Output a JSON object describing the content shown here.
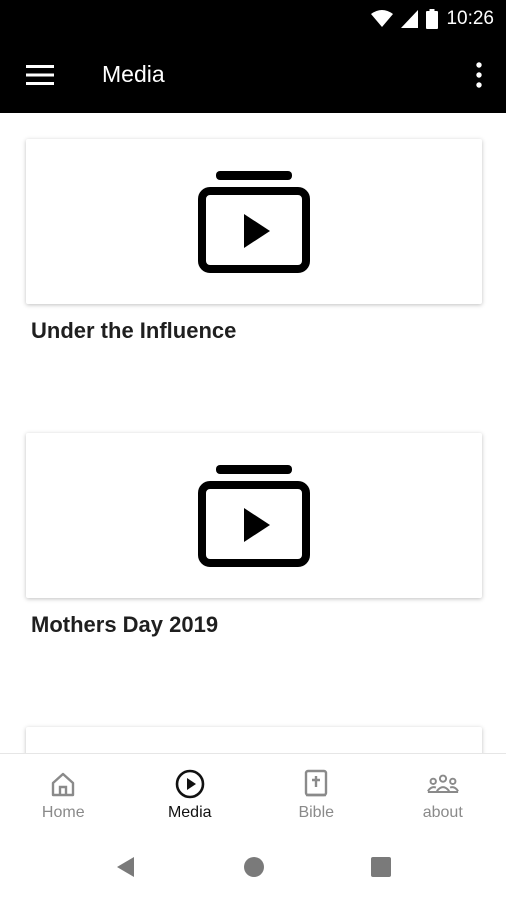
{
  "status_bar": {
    "time": "10:26"
  },
  "app_bar": {
    "title": "Media"
  },
  "media_items": [
    {
      "title": "Under the Influence"
    },
    {
      "title": "Mothers Day 2019"
    },
    {
      "title": ""
    }
  ],
  "bottom_nav": {
    "items": [
      {
        "label": "Home",
        "icon": "home-icon"
      },
      {
        "label": "Media",
        "icon": "play-circle-icon",
        "active": true
      },
      {
        "label": "Bible",
        "icon": "bible-icon"
      },
      {
        "label": "about",
        "icon": "people-icon"
      }
    ]
  },
  "colors": {
    "app_bar": "#000000",
    "active_nav": "#111111",
    "inactive_nav": "#8a8a8a"
  }
}
